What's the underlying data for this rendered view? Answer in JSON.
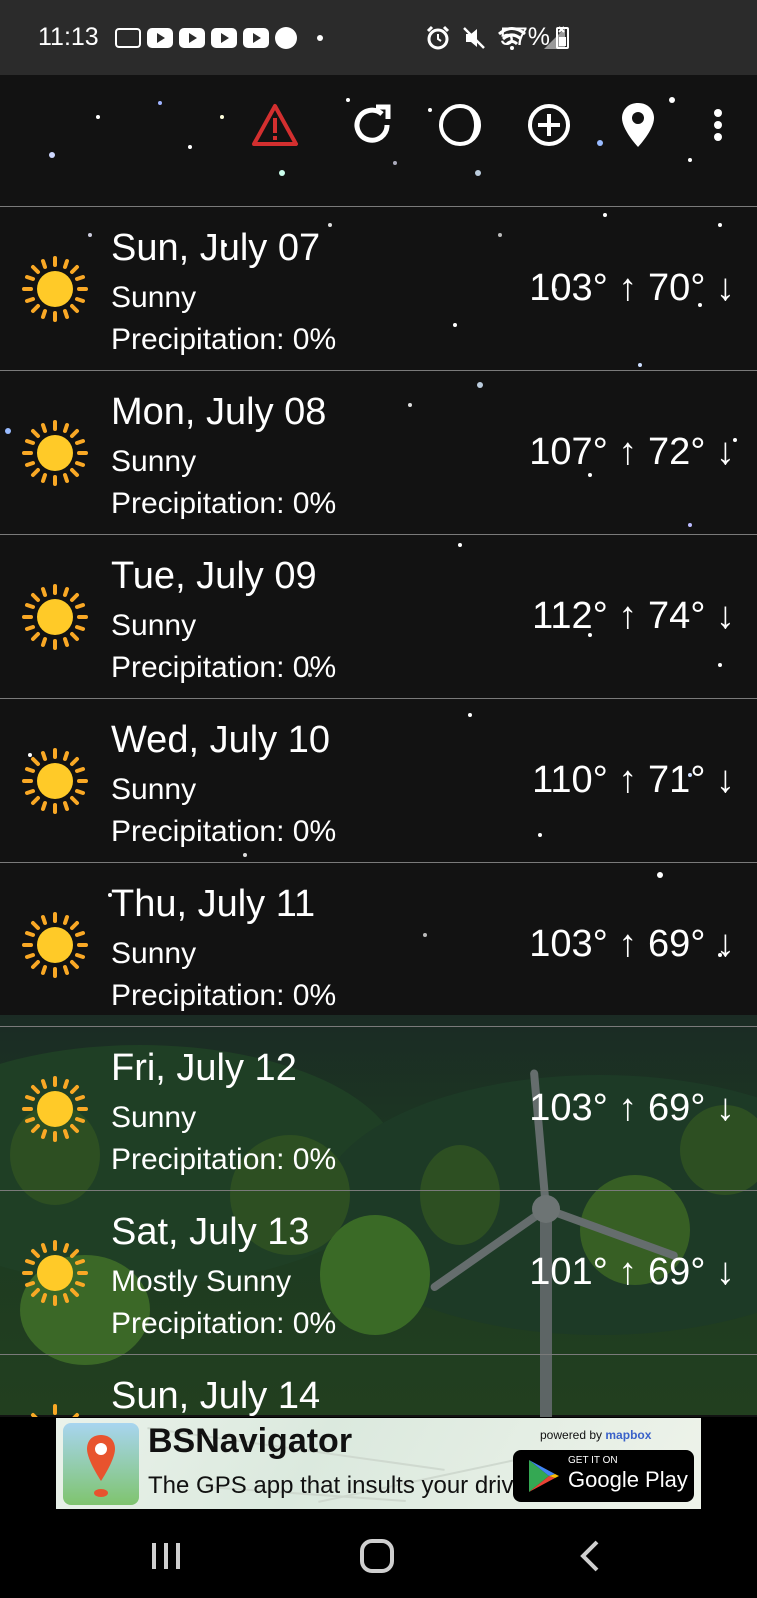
{
  "status_bar": {
    "time": "11:13",
    "battery": "57%"
  },
  "forecast": [
    {
      "date": "Sun, July 07",
      "condition": "Sunny",
      "precipitation": "Precipitation:  0%",
      "temps": "103° ↑ 70° ↓"
    },
    {
      "date": "Mon, July 08",
      "condition": "Sunny",
      "precipitation": "Precipitation:  0%",
      "temps": "107° ↑ 72° ↓"
    },
    {
      "date": "Tue, July 09",
      "condition": "Sunny",
      "precipitation": "Precipitation:  0%",
      "temps": "112° ↑ 74° ↓"
    },
    {
      "date": "Wed, July 10",
      "condition": "Sunny",
      "precipitation": "Precipitation:  0%",
      "temps": "110° ↑ 71° ↓"
    },
    {
      "date": "Thu, July 11",
      "condition": "Sunny",
      "precipitation": "Precipitation:  0%",
      "temps": "103° ↑ 69° ↓"
    },
    {
      "date": "Fri, July 12",
      "condition": "Sunny",
      "precipitation": "Precipitation:  0%",
      "temps": "103° ↑ 69° ↓"
    },
    {
      "date": "Sat, July 13",
      "condition": "Mostly Sunny",
      "precipitation": "Precipitation:  0%",
      "temps": "101° ↑ 69° ↓"
    },
    {
      "date": "Sun, July 14",
      "condition": "",
      "precipitation": "",
      "temps": ""
    }
  ],
  "ad": {
    "title": "BSNavigator",
    "subtitle": "The GPS app that insults your driving.",
    "powered_by": "powered by",
    "mapbox": "mapbox",
    "store_small": "GET IT ON",
    "store_big": "Google Play"
  },
  "colors": {
    "background": "#121212",
    "warning": "#d32f2f",
    "sun": "#ffca28",
    "sun_rays": "#f9a825"
  }
}
